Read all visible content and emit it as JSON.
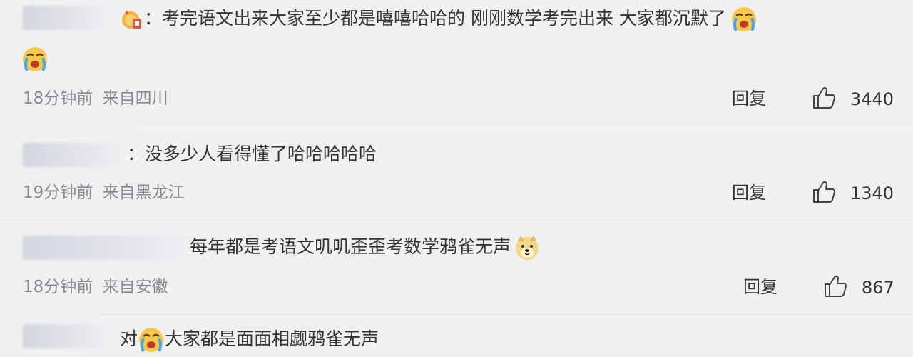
{
  "comments": [
    {
      "text_line1": "考完语文出来大家至少都是嘻嘻哈哈的 刚刚数学考完出来 大家都沉默了",
      "prefix": "：",
      "time": "18分钟前",
      "location": "来自四川",
      "reply": "回复",
      "likes": "3440",
      "emoji_1": "crying-face-emoji",
      "emoji_2": "crying-face-emoji",
      "badge": "fan-badge-icon"
    },
    {
      "text_line1": "没多少人看得懂了哈哈哈哈哈",
      "prefix": "：",
      "time": "19分钟前",
      "location": "来自黑龙江",
      "reply": "回复",
      "likes": "1340"
    },
    {
      "text_line1": "每年都是考语文叽叽歪歪考数学鸦雀无声",
      "time": "18分钟前",
      "location": "来自安徽",
      "reply": "回复",
      "likes": "867",
      "emoji_1": "doge-emoji"
    },
    {
      "text_pre": "对",
      "text_line1": "大家都是面面相觑鸦雀无声",
      "emoji_1": "crying-face-emoji"
    }
  ],
  "icons": {
    "like": "thumbs-up-icon"
  },
  "colors": {
    "background": "#f0f0f2",
    "text": "#333333",
    "meta": "#8a8a8f",
    "emoji_yellow": "#f7c948"
  }
}
